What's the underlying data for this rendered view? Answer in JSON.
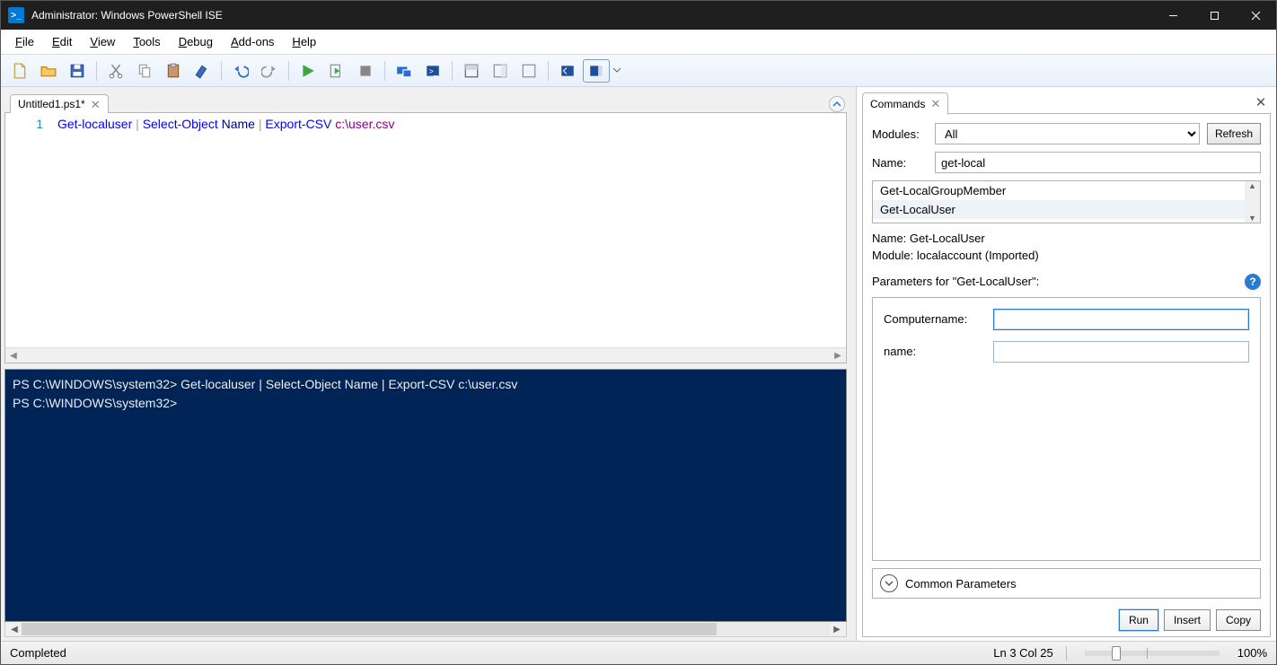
{
  "window": {
    "title": "Administrator: Windows PowerShell ISE"
  },
  "menu": {
    "items": [
      "File",
      "Edit",
      "View",
      "Tools",
      "Debug",
      "Add-ons",
      "Help"
    ]
  },
  "editor": {
    "tab_label": "Untitled1.ps1*",
    "line_number": "1",
    "tokens": {
      "cmd1": "Get-localuser",
      "pipe": "|",
      "cmd2": "Select-Object",
      "param": "Name",
      "cmd3": "Export-CSV",
      "path": "c:\\user.csv"
    }
  },
  "console": {
    "line1": "PS C:\\WINDOWS\\system32> Get-localuser | Select-Object Name | Export-CSV c:\\user.csv",
    "line2": "",
    "line3": "PS C:\\WINDOWS\\system32> "
  },
  "commands_panel": {
    "tab_label": "Commands",
    "modules_label": "Modules:",
    "modules_value": "All",
    "refresh_label": "Refresh",
    "name_label": "Name:",
    "name_value": "get-local",
    "results": [
      "Get-LocalGroupMember",
      "Get-LocalUser"
    ],
    "info_name": "Name: Get-LocalUser",
    "info_module": "Module: localaccount (Imported)",
    "params_title": "Parameters for \"Get-LocalUser\":",
    "param_rows": [
      {
        "label": "Computername:",
        "value": ""
      },
      {
        "label": "name:",
        "value": ""
      }
    ],
    "common_params_label": "Common Parameters",
    "run_label": "Run",
    "insert_label": "Insert",
    "copy_label": "Copy"
  },
  "status": {
    "text": "Completed",
    "position": "Ln 3  Col 25",
    "zoom": "100%"
  }
}
